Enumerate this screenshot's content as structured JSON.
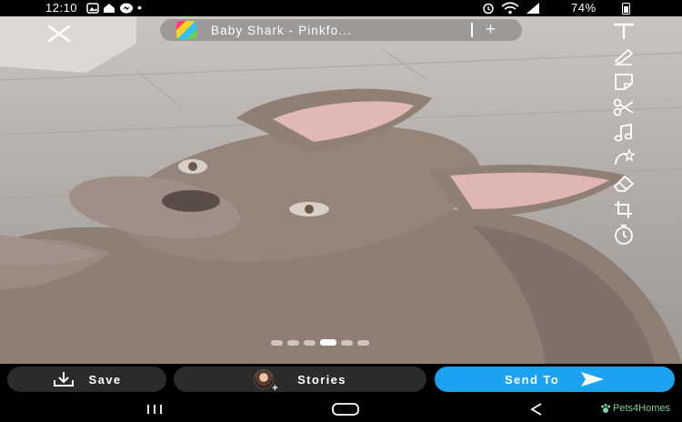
{
  "status_bar": {
    "time": "12:10",
    "battery": "74%"
  },
  "music": {
    "song_title": "Baby Shark - Pinkfo...",
    "add_symbol": "+"
  },
  "toolbar": {
    "tools": [
      "text-icon",
      "pen-icon",
      "sticker-icon",
      "scissors-icon",
      "music-note-icon",
      "magic-wand-icon",
      "eraser-icon",
      "crop-icon",
      "timer-icon"
    ]
  },
  "pager": {
    "count": 6,
    "active_index": 3
  },
  "actions": {
    "save_label": "Save",
    "stories_label": "Stories",
    "send_label": "Send To"
  },
  "watermark": {
    "text": "Pets4Homes"
  },
  "colors": {
    "send_button": "#1ba3f2",
    "secondary_button": "#2b2b2b"
  }
}
